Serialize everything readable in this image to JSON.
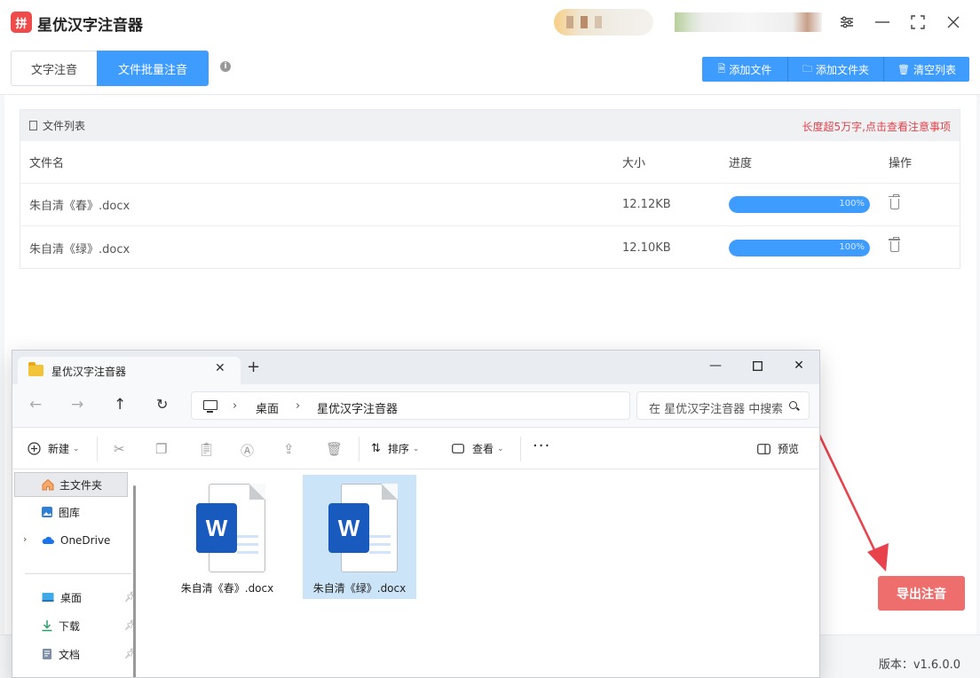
{
  "app": {
    "title": "星优汉字注音器",
    "logo_text": "拼"
  },
  "tabs": [
    {
      "label": "文字注音"
    },
    {
      "label": "文件批量注音"
    }
  ],
  "toolbar": {
    "add_file": "添加文件",
    "add_folder": "添加文件夹",
    "clear_list": "清空列表"
  },
  "file_list": {
    "title": "文件列表",
    "notice": "长度超5万字,点击查看注意事项",
    "columns": {
      "name": "文件名",
      "size": "大小",
      "progress": "进度",
      "action": "操作"
    },
    "rows": [
      {
        "name": "朱自清《春》.docx",
        "size": "12.12KB",
        "progress": 100,
        "progress_label": "100%"
      },
      {
        "name": "朱自清《绿》.docx",
        "size": "12.10KB",
        "progress": 100,
        "progress_label": "100%"
      }
    ]
  },
  "export_button": "导出注音",
  "version": "版本：v1.6.0.0",
  "explorer": {
    "tab_title": "星优汉字注音器",
    "breadcrumb": [
      "桌面",
      "星优汉字注音器"
    ],
    "search_placeholder": "在 星优汉字注音器 中搜索",
    "commands": {
      "new": "新建",
      "sort": "排序",
      "view": "查看",
      "preview": "预览"
    },
    "nav": [
      {
        "label": "主文件夹",
        "icon": "home-icon"
      },
      {
        "label": "图库",
        "icon": "gallery-icon"
      },
      {
        "label": "OneDrive",
        "icon": "cloud-icon"
      },
      {
        "label": "桌面",
        "icon": "desktop-icon"
      },
      {
        "label": "下载",
        "icon": "download-icon"
      },
      {
        "label": "文档",
        "icon": "documents-icon"
      }
    ],
    "files": [
      {
        "name": "朱自清《春》.docx",
        "badge": "W"
      },
      {
        "name": "朱自清《绿》.docx",
        "badge": "W"
      }
    ]
  },
  "colors": {
    "accent": "#3f9cff",
    "export": "#ee6d6d",
    "notice": "#e0434c",
    "arrow": "#e8434c"
  }
}
